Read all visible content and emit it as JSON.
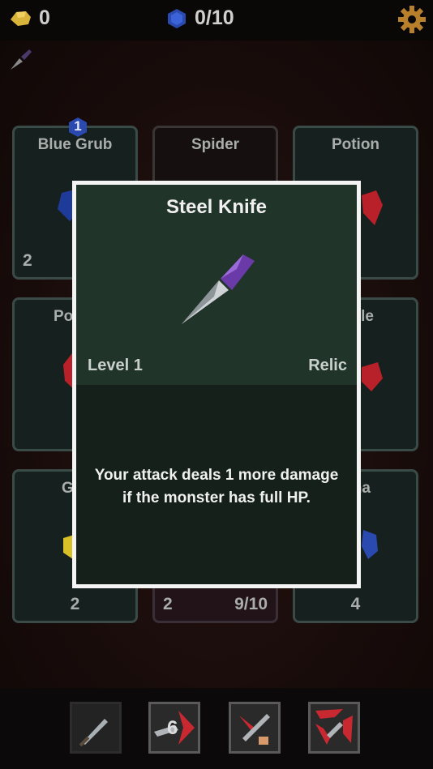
{
  "hud": {
    "gold_count": "0",
    "gem_count": "0/10",
    "icons": [
      "gold-icon",
      "gem-icon",
      "gear-icon"
    ]
  },
  "cards": [
    {
      "title": "Blue Grub",
      "left": "2",
      "badge": "1",
      "icon": "blue-grub-icon"
    },
    {
      "title": "Spider",
      "icon": "spider-icon"
    },
    {
      "title": "Potion",
      "icon": "potion-icon"
    },
    {
      "title": "Pot",
      "icon": "potion-icon"
    },
    {
      "title": "",
      "icon": ""
    },
    {
      "title": "ble",
      "icon": "red-gem-icon"
    },
    {
      "title": "G",
      "center": "2",
      "icon": "yellow-grub-icon"
    },
    {
      "title": "",
      "left": "2",
      "right": "9/10",
      "icon": ""
    },
    {
      "title": "na",
      "center": "4",
      "icon": "blue-gem-icon"
    }
  ],
  "modal": {
    "title": "Steel Knife",
    "level": "Level 1",
    "rarity": "Relic",
    "description_line1": "Your attack deals 1 more damage",
    "description_line2": "if the monster has full HP.",
    "icon": "steel-knife-icon"
  },
  "skills": [
    {
      "name": "sword-skill-icon"
    },
    {
      "name": "throw-skill-icon",
      "count": "6"
    },
    {
      "name": "slash-skill-icon"
    },
    {
      "name": "spin-skill-icon"
    }
  ],
  "colors": {
    "modal_border": "#f4f4f4",
    "modal_head": "#20342a",
    "modal_body": "#15201a",
    "card_border": "#3a4a47"
  }
}
